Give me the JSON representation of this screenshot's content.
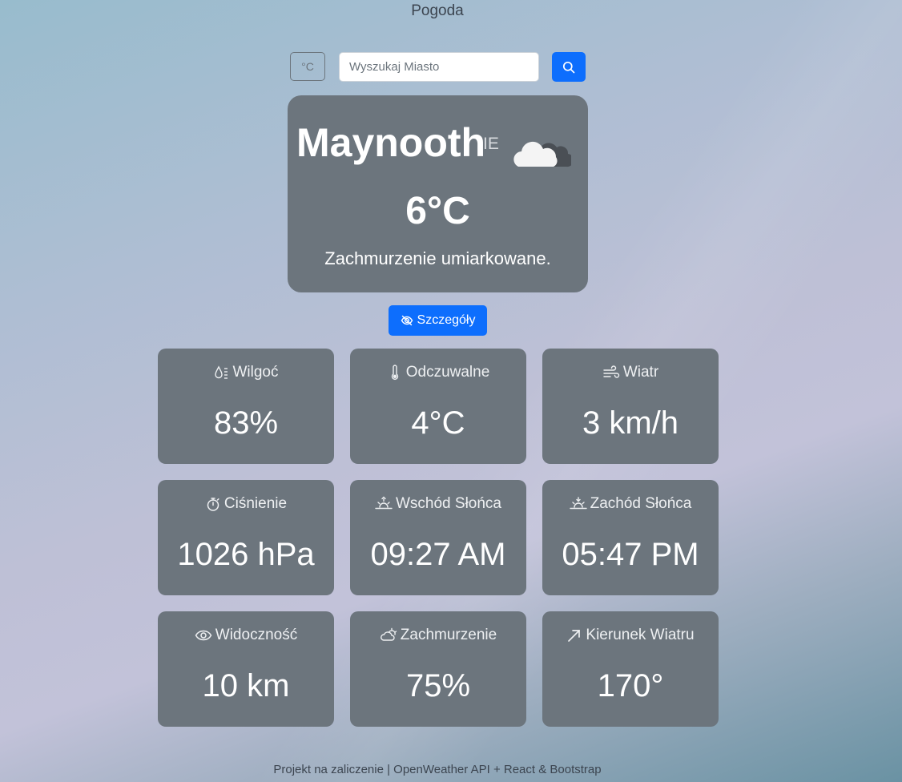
{
  "app": {
    "title": "Pogoda"
  },
  "search": {
    "unit_label": "°C",
    "placeholder": "Wyszukaj Miasto",
    "value": ""
  },
  "current": {
    "city": "Maynooth",
    "country": "IE",
    "temperature": "6°C",
    "description": "Zachmurzenie umiarkowane.",
    "icon": "cloudy-icon"
  },
  "details_button": {
    "label": "Szczegóły",
    "icon": "eye-slash-icon"
  },
  "tiles": [
    {
      "label": "Wilgoć",
      "value": "83%",
      "icon": "humidity-icon"
    },
    {
      "label": "Odczuwalne",
      "value": "4°C",
      "icon": "thermometer-icon"
    },
    {
      "label": "Wiatr",
      "value": "3 km/h",
      "icon": "wind-icon"
    },
    {
      "label": "Ciśnienie",
      "value": "1026 hPa",
      "icon": "stopwatch-icon"
    },
    {
      "label": "Wschód Słońca",
      "value": "09:27 AM",
      "icon": "sunrise-icon"
    },
    {
      "label": "Zachód Słońca",
      "value": "05:47 PM",
      "icon": "sunset-icon"
    },
    {
      "label": "Widoczność",
      "value": "10 km",
      "icon": "eye-icon"
    },
    {
      "label": "Zachmurzenie",
      "value": "75%",
      "icon": "cloud-sun-icon"
    },
    {
      "label": "Kierunek Wiatru",
      "value": "170°",
      "icon": "arrow-up-right-icon"
    }
  ],
  "footer": {
    "text": "Projekt na zaliczenie | OpenWeather API + React & Bootstrap"
  },
  "colors": {
    "primary": "#0d6efd",
    "card": "#6c757d"
  }
}
